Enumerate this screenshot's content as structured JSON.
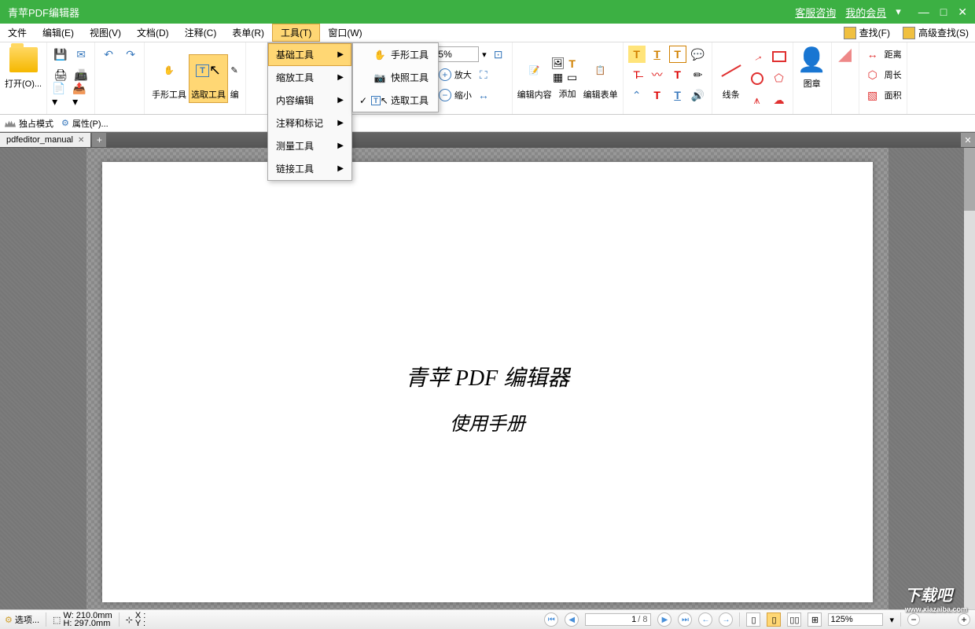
{
  "titlebar": {
    "title": "青苹PDF编辑器",
    "support": "客服咨询",
    "member": "我的会员"
  },
  "menubar": {
    "items": [
      "文件",
      "编辑(E)",
      "视图(V)",
      "文档(D)",
      "注释(C)",
      "表单(R)",
      "工具(T)",
      "窗口(W)"
    ],
    "find": "查找(F)",
    "advfind": "高级查找(S)"
  },
  "ribbon": {
    "open": "打开(O)...",
    "handtool": "手形工具",
    "selecttool": "选取工具",
    "edit_short": "编",
    "zoom_value": "125%",
    "zoomin": "放大",
    "zoomout": "缩小",
    "editcontent": "编辑内容",
    "add": "添加",
    "editform": "编辑表单",
    "lines": "线条",
    "stamp": "图章",
    "distance": "距离",
    "perimeter": "周长",
    "area": "面积"
  },
  "dropdown": {
    "items": [
      "基础工具",
      "缩放工具",
      "内容编辑",
      "注释和标记",
      "测量工具",
      "链接工具"
    ]
  },
  "submenu": {
    "hand": "手形工具",
    "snapshot": "快照工具",
    "select": "选取工具"
  },
  "propbar": {
    "exclusive": "独占模式",
    "properties": "属性(P)..."
  },
  "tab": {
    "name": "pdfeditor_manual"
  },
  "document": {
    "line1": "青苹 PDF 编辑器",
    "line2": "使用手册"
  },
  "statusbar": {
    "options": "选项...",
    "width": "W:  210.0mm",
    "height": "H:  297.0mm",
    "x": "X :",
    "y": "Y :",
    "page_current": "1",
    "page_total": "/ 8",
    "zoom": "125%"
  },
  "watermark": {
    "main": "下载吧",
    "sub": "www.xiazaiba.com"
  }
}
